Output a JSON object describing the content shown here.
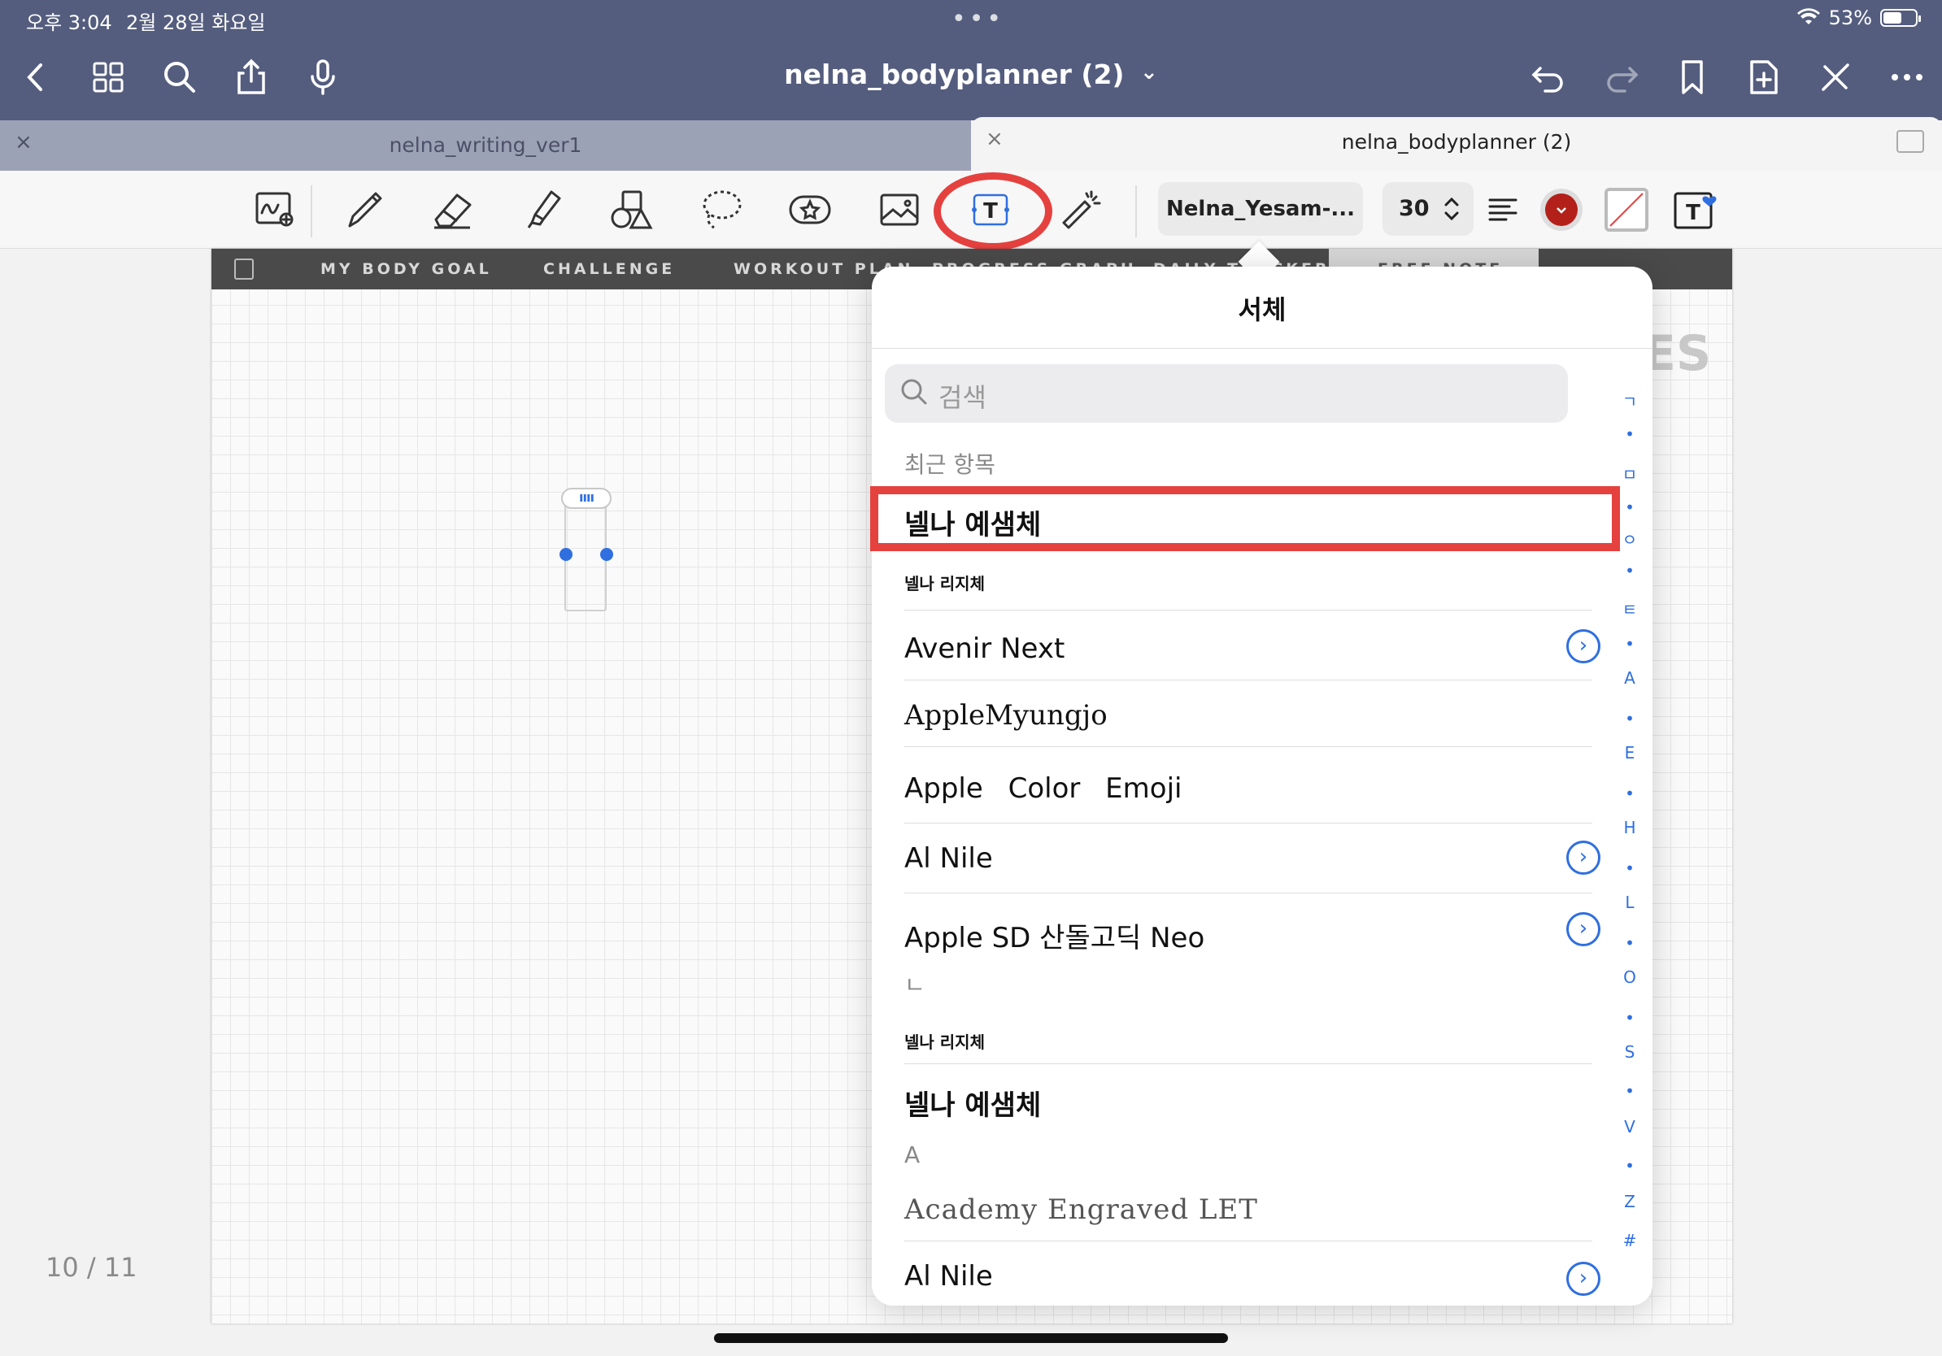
{
  "status": {
    "time": "오후 3:04",
    "date": "2월 28일 화요일",
    "dots": "•••",
    "battery": "53%"
  },
  "nav": {
    "title": "nelna_bodyplanner (2)",
    "title_chevron": "⌄"
  },
  "tabs": [
    {
      "label": "nelna_writing_ver1",
      "close": "×"
    },
    {
      "label": "nelna_bodyplanner (2)",
      "close": "×"
    }
  ],
  "toolbar": {
    "font_name": "Nelna_Yesam-...",
    "font_size": "30",
    "size_chevron": "⌃⌄",
    "color_swatch": "#b3201a",
    "accent": "#e5413f"
  },
  "planner_tabs": [
    "MY BODY GOAL",
    "CHALLENGE",
    "WORKOUT PLAN",
    "PROGRESS GRAPH",
    "DAILY TRACKER",
    "FREE NOTE"
  ],
  "canvas": {
    "ghost_text": "ES",
    "page_counter": "10 / 11",
    "textbox_handle": "ıııı"
  },
  "popover": {
    "title": "서체",
    "search_placeholder": "검색",
    "recent_header": "최근 항목",
    "rows": [
      {
        "label": "넬나 예샘체",
        "chevron": false
      },
      {
        "label": "넬나 리지체",
        "chevron": false
      },
      {
        "label": "Avenir Next",
        "chevron": true
      },
      {
        "label": "AppleMyungjo",
        "chevron": false
      },
      {
        "label": "Apple Color Emoji",
        "chevron": false
      },
      {
        "label": "Al Nile",
        "chevron": true
      },
      {
        "label": "Apple SD 산돌고딕 Neo",
        "chevron": true
      }
    ],
    "section_n": "ㄴ",
    "rows_n": [
      {
        "label": "넬나 리지체"
      },
      {
        "label": "넬나 예샘체"
      }
    ],
    "section_a": "A",
    "rows_a": [
      {
        "label": "Academy Engraved LET",
        "chevron": false
      },
      {
        "label": "Al Nile",
        "chevron": true
      }
    ],
    "chevron_glyph": "›",
    "index": [
      "ㄱ",
      "•",
      "ㅁ",
      "•",
      "ㅇ",
      "•",
      "ㅌ",
      "•",
      "A",
      "•",
      "E",
      "•",
      "H",
      "•",
      "L",
      "•",
      "O",
      "•",
      "S",
      "•",
      "V",
      "•",
      "Z",
      "#"
    ]
  }
}
